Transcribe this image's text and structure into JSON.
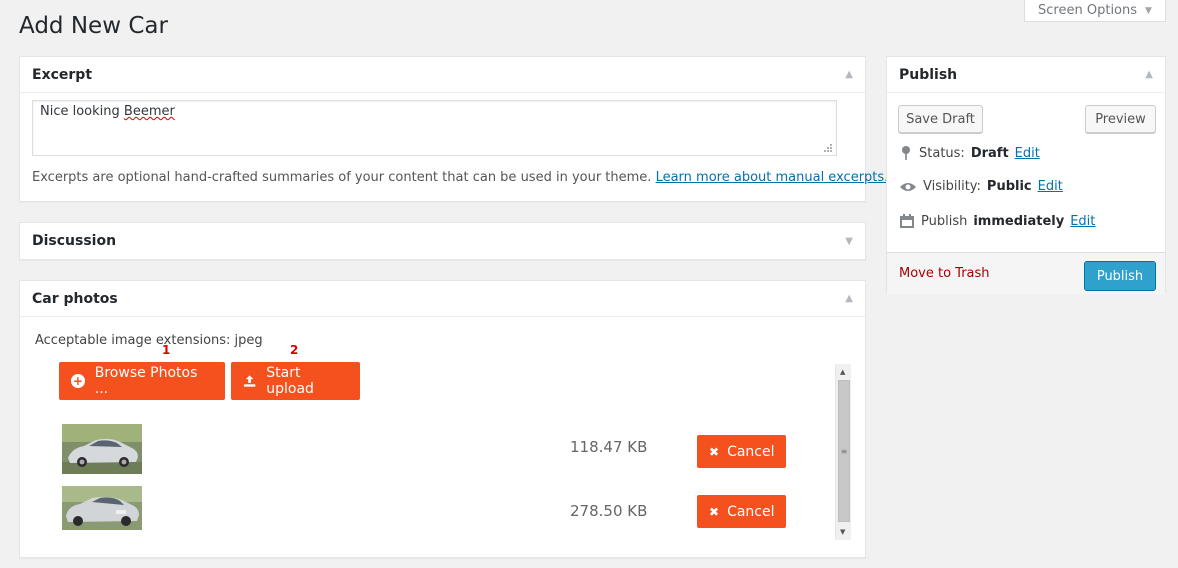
{
  "page": {
    "title": "Add New Car",
    "screen_options_label": "Screen Options"
  },
  "excerpt": {
    "title": "Excerpt",
    "value_prefix": "Nice looking ",
    "value_misspelled": "Beemer",
    "help_text": "Excerpts are optional hand-crafted summaries of your content that can be used in your theme.",
    "help_link": "Learn more about manual excerpts."
  },
  "discussion": {
    "title": "Discussion"
  },
  "car_photos": {
    "title": "Car photos",
    "extensions_text": "Acceptable image extensions: jpeg",
    "browse_label": "Browse Photos ...",
    "upload_label": "Start upload",
    "marker_1": "1",
    "marker_2": "2",
    "files": [
      {
        "size": "118.47 KB",
        "cancel_label": "Cancel"
      },
      {
        "size": "278.50 KB",
        "cancel_label": "Cancel"
      }
    ]
  },
  "publish": {
    "title": "Publish",
    "save_draft": "Save Draft",
    "preview": "Preview",
    "status_label": "Status:",
    "status_value": "Draft",
    "visibility_label": "Visibility:",
    "visibility_value": "Public",
    "publish_label": "Publish",
    "publish_value": "immediately",
    "edit_label": "Edit",
    "trash_label": "Move to Trash",
    "publish_button": "Publish"
  },
  "colors": {
    "accent_orange": "#f4511e",
    "publish_blue": "#2ea2cc",
    "link": "#0073aa",
    "trash_red": "#aa0000"
  }
}
